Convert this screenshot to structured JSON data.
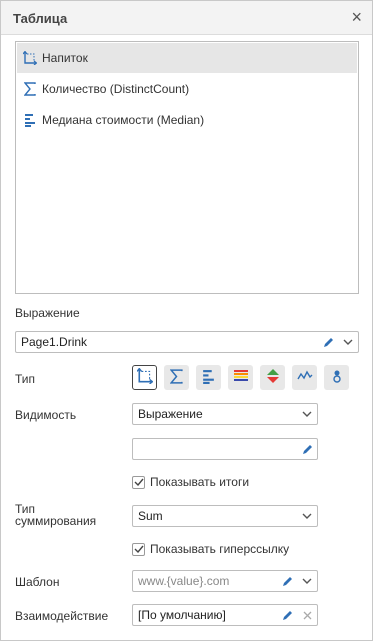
{
  "panel": {
    "title": "Таблица",
    "close_label": "×"
  },
  "fields": [
    {
      "label": "Напиток",
      "icon": "dimension-axis-icon",
      "selected": true
    },
    {
      "label": "Количество (DistinctCount)",
      "icon": "sigma-icon",
      "selected": false
    },
    {
      "label": "Медиана стоимости (Median)",
      "icon": "align-left-bars-icon",
      "selected": false
    }
  ],
  "expression": {
    "label": "Выражение",
    "value": "Page1.Drink"
  },
  "type": {
    "label": "Тип",
    "buttons": [
      {
        "icon": "dimension-axis-icon",
        "active": true
      },
      {
        "icon": "sigma-icon",
        "active": false
      },
      {
        "icon": "align-left-bars-icon",
        "active": false
      },
      {
        "icon": "color-bars-icon",
        "active": false
      },
      {
        "icon": "up-down-arrows-icon",
        "active": false
      },
      {
        "icon": "sparkline-icon",
        "active": false
      },
      {
        "icon": "indicator-icon",
        "active": false
      }
    ]
  },
  "visibility": {
    "label": "Видимость",
    "value": "Выражение",
    "expression_value": ""
  },
  "show_totals": {
    "label": "Показывать итоги",
    "checked": true
  },
  "summary_type": {
    "label_line1": "Тип",
    "label_line2": "суммирования",
    "value": "Sum"
  },
  "show_hyperlink": {
    "label": "Показывать гиперссылку",
    "checked": true
  },
  "template": {
    "label": "Шаблон",
    "placeholder": "www.{value}.com"
  },
  "interaction": {
    "label": "Взаимодействие",
    "value": "[По умолчанию]"
  },
  "colors": {
    "accent_blue": "#2f6fb5",
    "border": "#bdbdbd",
    "selected_row": "#e6e6e6"
  }
}
